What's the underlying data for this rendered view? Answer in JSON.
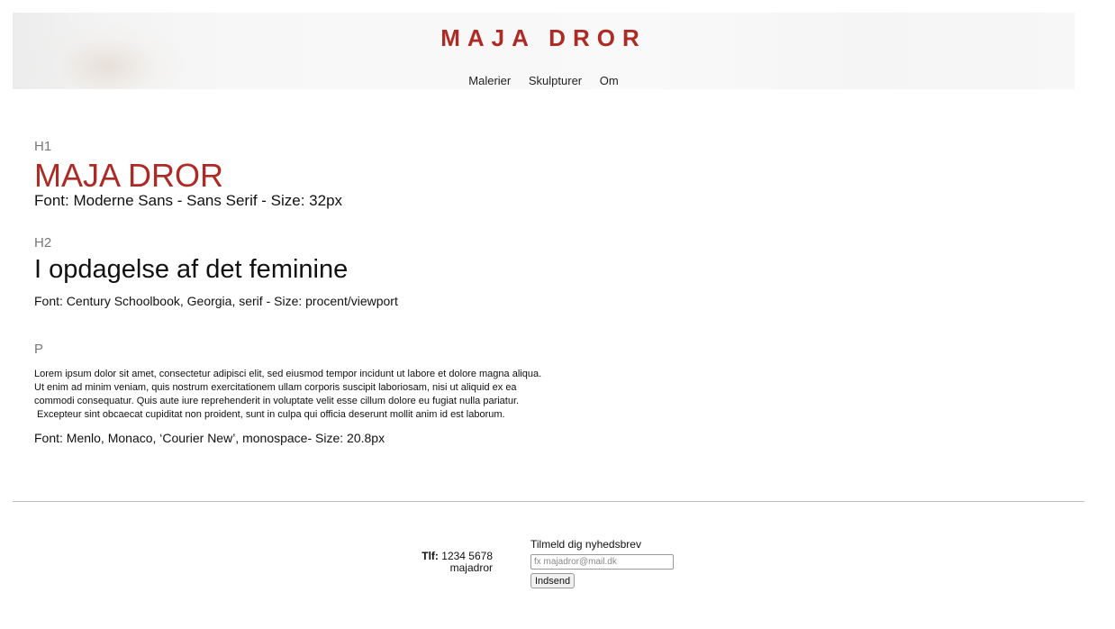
{
  "header": {
    "logo": "MAJA DROR",
    "nav": [
      "Malerier",
      "Skulpturer",
      "Om"
    ]
  },
  "styleguide": {
    "h1": {
      "label": "H1",
      "sample": "MAJA DROR",
      "description": "Font: Moderne Sans - Sans Serif - Size: 32px"
    },
    "h2": {
      "label": "H2",
      "sample": "I opdagelse af det feminine",
      "description": "Font: Century Schoolbook, Georgia, serif - Size: procent/viewport"
    },
    "p": {
      "label": "P",
      "lines": [
        "Lorem ipsum dolor sit amet, consectetur adipisci elit, sed eiusmod tempor incidunt ut labore et dolore magna aliqua.",
        "Ut enim ad minim veniam, quis nostrum exercitationem ullam corporis suscipit laboriosam, nisi ut aliquid ex ea",
        "commodi consequatur. Quis aute iure reprehenderit in voluptate velit esse cillum dolore eu fugiat nulla pariatur.",
        " Excepteur sint obcaecat cupiditat non proident, sunt in culpa qui officia deserunt mollit anim id est laborum."
      ],
      "description": "Font: Menlo, Monaco, ‘Courier New’, monospace- Size: 20.8px"
    }
  },
  "footer": {
    "phone_label": "Tlf:",
    "phone": "1234 5678",
    "handle": "majadror",
    "newsletter_title": "Tilmeld dig nyhedsbrev",
    "email_placeholder": "fx majadror@mail.dk",
    "send_label": "Indsend"
  },
  "colors": {
    "accent": "#ad2a25",
    "divider": "#bdbdbd"
  }
}
